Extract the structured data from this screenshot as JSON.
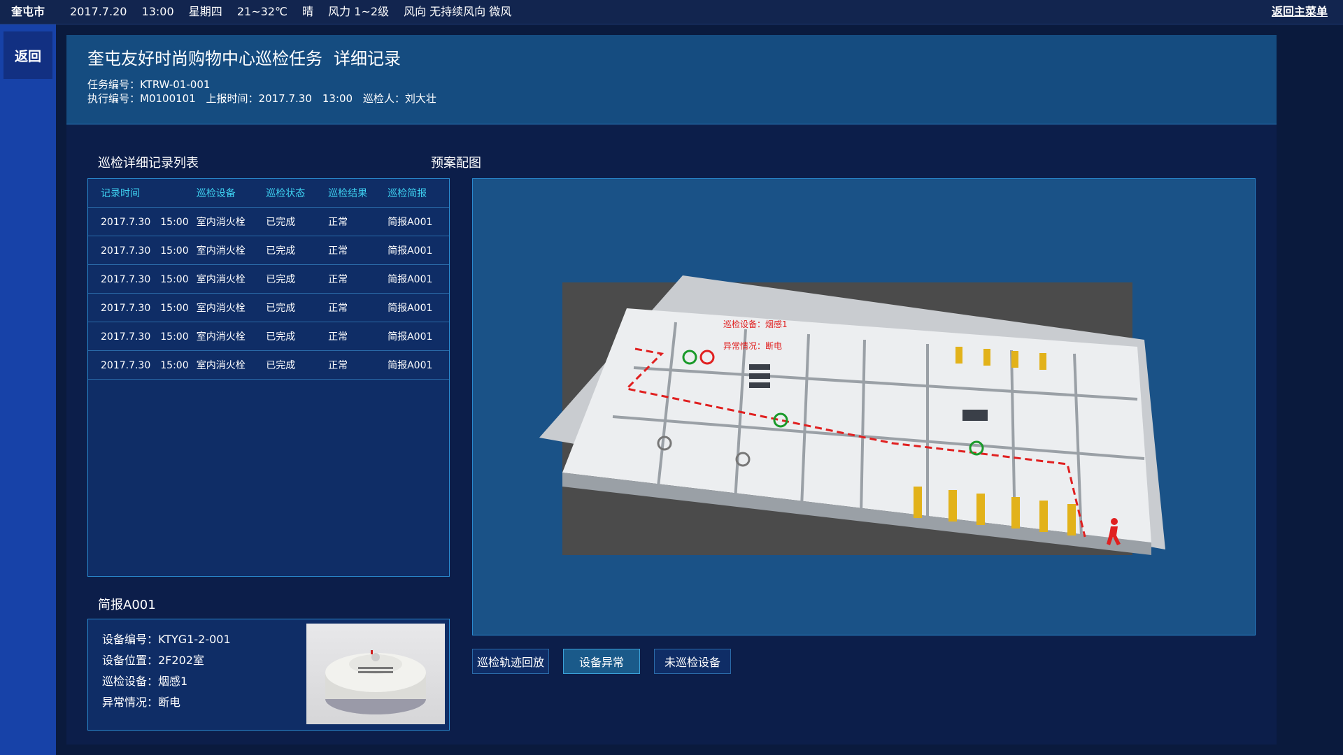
{
  "topbar": {
    "city": "奎屯市",
    "date": "2017.7.20",
    "time": "13:00",
    "weekday": "星期四",
    "temperature": "21~32℃",
    "weather": "晴",
    "wind_force": "风力 1~2级",
    "wind_direction": "风向 无持续风向 微风",
    "back_main": "返回主菜单"
  },
  "sidebar": {
    "back": "返回"
  },
  "header": {
    "title": "奎屯友好时尚购物中心巡检任务",
    "subtitle": "详细记录",
    "task_no": "任务编号：KTRW-01-001",
    "exec_no": "执行编号：M0100101",
    "report_time": "上报时间：2017.7.30　13:00",
    "inspector": "巡检人：刘大壮"
  },
  "list": {
    "title": "巡检详细记录列表",
    "columns": [
      "记录时间",
      "巡检设备",
      "巡检状态",
      "巡检结果",
      "巡检简报"
    ],
    "rows": [
      [
        "2017.7.30　15:00",
        "室内消火栓",
        "已完成",
        "正常",
        "简报A001"
      ],
      [
        "2017.7.30　15:00",
        "室内消火栓",
        "已完成",
        "正常",
        "简报A001"
      ],
      [
        "2017.7.30　15:00",
        "室内消火栓",
        "已完成",
        "正常",
        "简报A001"
      ],
      [
        "2017.7.30　15:00",
        "室内消火栓",
        "已完成",
        "正常",
        "简报A001"
      ],
      [
        "2017.7.30　15:00",
        "室内消火栓",
        "已完成",
        "正常",
        "简报A001"
      ],
      [
        "2017.7.30　15:00",
        "室内消火栓",
        "已完成",
        "正常",
        "简报A001"
      ]
    ]
  },
  "brief": {
    "title": "简报A001",
    "device_no": "设备编号：KTYG1-2-001",
    "location": "设备位置：2F202室",
    "device": "巡检设备：烟感1",
    "abnormal": "异常情况：断电"
  },
  "map": {
    "title": "预案配图",
    "annotation_device": "巡检设备：烟感1",
    "annotation_abnormal": "异常情况：断电"
  },
  "buttons": {
    "playback": "巡检轨迹回放",
    "abnormal": "设备异常",
    "uninspected": "未巡检设备"
  },
  "colors": {
    "accent": "#3ed0f0",
    "route": "#e02020",
    "normal": "#1a9a2a",
    "abnormal": "#e02020"
  }
}
